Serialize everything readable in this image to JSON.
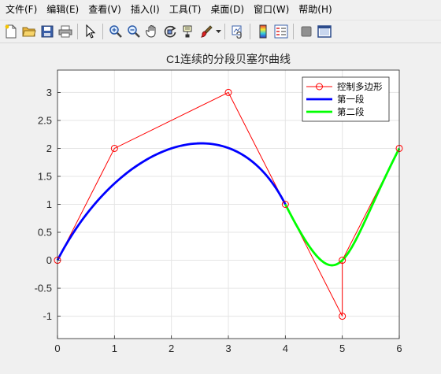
{
  "menubar": {
    "items": [
      {
        "label": "文件(F)"
      },
      {
        "label": "编辑(E)"
      },
      {
        "label": "查看(V)"
      },
      {
        "label": "插入(I)"
      },
      {
        "label": "工具(T)"
      },
      {
        "label": "桌面(D)"
      },
      {
        "label": "窗口(W)"
      },
      {
        "label": "帮助(H)"
      }
    ]
  },
  "toolbar": {
    "buttons": [
      {
        "icon": "new-file-icon"
      },
      {
        "icon": "open-folder-icon"
      },
      {
        "icon": "save-icon"
      },
      {
        "icon": "print-icon"
      },
      {
        "icon": "pointer-icon"
      },
      {
        "icon": "zoom-in-icon"
      },
      {
        "icon": "zoom-out-icon"
      },
      {
        "icon": "pan-hand-icon"
      },
      {
        "icon": "rotate-3d-icon"
      },
      {
        "icon": "data-cursor-icon"
      },
      {
        "icon": "brush-icon"
      },
      {
        "icon": "link-plot-icon"
      },
      {
        "icon": "colorbar-icon"
      },
      {
        "icon": "legend-icon"
      },
      {
        "icon": "hide-plot-tools-icon"
      },
      {
        "icon": "show-plot-tools-icon"
      }
    ]
  },
  "colors": {
    "control_polygon": "#ff0000",
    "segment1": "#0000ff",
    "segment2": "#00ff00",
    "grid": "#e5e5e5",
    "axes": "#262626"
  },
  "chart_data": {
    "type": "line",
    "title": "C1连续的分段贝塞尔曲线",
    "xlabel": "",
    "ylabel": "",
    "xlim": [
      0,
      6
    ],
    "ylim": [
      -1.4,
      3.4
    ],
    "xticks": [
      0,
      1,
      2,
      3,
      4,
      5,
      6
    ],
    "yticks": [
      -1,
      -0.5,
      0,
      0.5,
      1,
      1.5,
      2,
      2.5,
      3
    ],
    "xtick_labels": [
      "0",
      "1",
      "2",
      "3",
      "4",
      "5",
      "6"
    ],
    "ytick_labels": [
      "-1",
      "-0.5",
      "0",
      "0.5",
      "1",
      "1.5",
      "2",
      "2.5",
      "3"
    ],
    "grid": true,
    "legend_position": "top-right",
    "series": [
      {
        "name": "控制多边形",
        "style": "line-with-circle-markers",
        "color": "#ff0000",
        "x": [
          0,
          1,
          3,
          4,
          5,
          5,
          6
        ],
        "y": [
          0,
          2,
          3,
          1,
          -1,
          0,
          2
        ]
      },
      {
        "name": "第一段",
        "style": "thick-line",
        "color": "#0000ff",
        "bezier_control_x": [
          0,
          1,
          3,
          4
        ],
        "bezier_control_y": [
          0,
          2,
          3,
          1
        ]
      },
      {
        "name": "第二段",
        "style": "thick-line",
        "color": "#00ff00",
        "bezier_control_x": [
          4,
          5,
          5,
          6
        ],
        "bezier_control_y": [
          1,
          -1,
          0,
          2
        ]
      }
    ]
  }
}
